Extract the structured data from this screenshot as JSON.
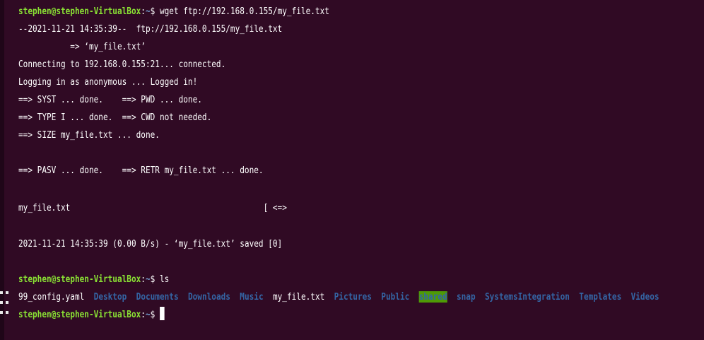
{
  "window": {
    "title": "stephen@stephen-VirtualBox: ~"
  },
  "colors": {
    "background": "#300a24",
    "prompt_user": "#8ae234",
    "prompt_path": "#729fcf",
    "directory": "#3465a4",
    "highlight_bg": "#4e9a06"
  },
  "terminal": {
    "prompt_user_host": "stephen@stephen-VirtualBox",
    "prompt_path": "~",
    "prompt_symbol": "$",
    "cmd1": " wget ftp://192.168.0.155/my_file.txt",
    "out": [
      "--2021-11-21 14:35:39--  ftp://192.168.0.155/my_file.txt",
      "           => ‘my_file.txt’",
      "Connecting to 192.168.0.155:21... connected.",
      "Logging in as anonymous ... Logged in!",
      "==> SYST ... done.    ==> PWD ... done.",
      "==> TYPE I ... done.  ==> CWD not needed.",
      "==> SIZE my_file.txt ... done.",
      "==> PASV ... done.    ==> RETR my_file.txt ... done.",
      "my_file.txt                                         [ <=>",
      "2021-11-21 14:35:39 (0.00 B/s) - ‘my_file.txt’ saved [0]"
    ],
    "cmd2": " ls",
    "ls_items": [
      {
        "name": "99_config.yaml",
        "type": "file"
      },
      {
        "name": "Desktop",
        "type": "dir"
      },
      {
        "name": "Documents",
        "type": "dir"
      },
      {
        "name": "Downloads",
        "type": "dir"
      },
      {
        "name": "Music",
        "type": "dir"
      },
      {
        "name": "my_file.txt",
        "type": "file"
      },
      {
        "name": "Pictures",
        "type": "dir"
      },
      {
        "name": "Public",
        "type": "dir"
      },
      {
        "name": "shared",
        "type": "dir-highlight"
      },
      {
        "name": "snap",
        "type": "dir"
      },
      {
        "name": "SystemsIntegration",
        "type": "dir"
      },
      {
        "name": "Templates",
        "type": "dir"
      },
      {
        "name": "Videos",
        "type": "dir"
      }
    ]
  },
  "dock": {
    "icon": "show-apps-grid-icon"
  }
}
